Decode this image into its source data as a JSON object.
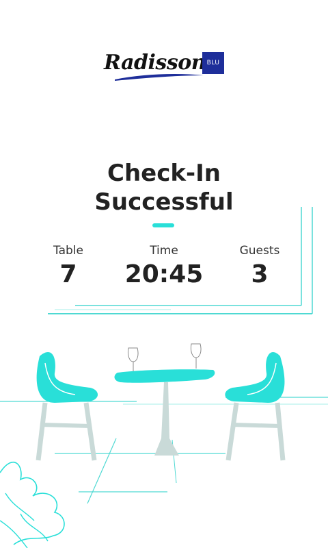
{
  "brand": {
    "name": "Radisson",
    "badge": "BLU",
    "accent_color": "#29dfd8",
    "badge_color": "#1e2e9a"
  },
  "headline": {
    "line1": "Check-In",
    "line2": "Successful"
  },
  "stats": [
    {
      "label": "Table",
      "value": "7"
    },
    {
      "label": "Time",
      "value": "20:45"
    },
    {
      "label": "Guests",
      "value": "3"
    }
  ]
}
